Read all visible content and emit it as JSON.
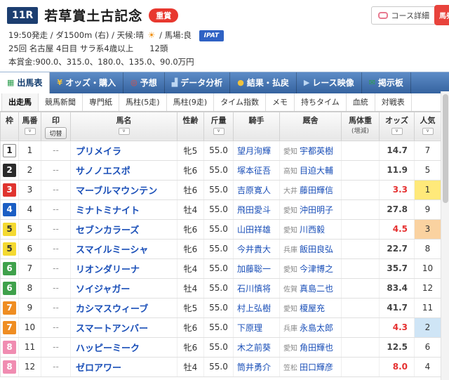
{
  "header": {
    "race_number": "11R",
    "race_name": "若草賞土古記念",
    "grade_badge": "重賞",
    "info1_a": "19:50発走 / ダ1500m (右) / 天候:晴",
    "sun_icon": "☀",
    "info1_b": "/ 馬場:良",
    "ipat": "IPAT",
    "info_line2": "25回 名古屋 4日目 サラ系4歳以上　　12頭",
    "info_line3": "本賞金:900.0、315.0、180.0、135.0、90.0万円",
    "course_detail_label": "コース詳細",
    "baken_label": "馬券"
  },
  "tabs": [
    {
      "label": "出馬表",
      "icon": "entry-table-icon",
      "icon_glyph": "▦",
      "icon_color": "green",
      "state": "active"
    },
    {
      "label": "オッズ・購入",
      "icon": "odds-purchase-icon",
      "icon_glyph": "¥",
      "icon_color": "gold",
      "state": "idle"
    },
    {
      "label": "予想",
      "icon": "prediction-icon",
      "icon_glyph": "◎",
      "icon_color": "red",
      "state": "idle"
    },
    {
      "label": "データ分析",
      "icon": "data-analysis-icon",
      "icon_glyph": "▟",
      "icon_color": "blue",
      "state": "idle"
    },
    {
      "label": "結果・払戻",
      "icon": "result-payout-icon",
      "icon_glyph": "●",
      "icon_color": "gold",
      "state": "idle"
    },
    {
      "label": "レース映像",
      "icon": "race-video-icon",
      "icon_glyph": "▶",
      "icon_color": "blue",
      "state": "idle"
    },
    {
      "label": "掲示板",
      "icon": "bbs-icon",
      "icon_glyph": "✉",
      "icon_color": "green",
      "state": "idle"
    }
  ],
  "subtabs": [
    {
      "label": "出走馬",
      "state": "active"
    },
    {
      "label": "競馬新聞",
      "state": "idle"
    },
    {
      "label": "専門紙",
      "state": "idle"
    },
    {
      "label": "馬柱(5走)",
      "state": "idle"
    },
    {
      "label": "馬柱(9走)",
      "state": "idle"
    },
    {
      "label": "タイム指数",
      "state": "idle"
    },
    {
      "label": "メモ",
      "state": "idle"
    },
    {
      "label": "持ちタイム",
      "state": "idle"
    },
    {
      "label": "血統",
      "state": "idle"
    },
    {
      "label": "対戦表",
      "state": "idle"
    }
  ],
  "table": {
    "headers": [
      {
        "label": "枠",
        "sub": "",
        "sort_glyph": "",
        "toggle": ""
      },
      {
        "label": "馬番",
        "sub": "",
        "sort_glyph": "∨",
        "toggle": ""
      },
      {
        "label": "印",
        "sub": "",
        "sort_glyph": "",
        "toggle": "切替"
      },
      {
        "label": "馬名",
        "sub": "",
        "sort_glyph": "∨",
        "toggle": ""
      },
      {
        "label": "性齢",
        "sub": "",
        "sort_glyph": "",
        "toggle": ""
      },
      {
        "label": "斤量",
        "sub": "",
        "sort_glyph": "∨",
        "toggle": ""
      },
      {
        "label": "騎手",
        "sub": "",
        "sort_glyph": "",
        "toggle": ""
      },
      {
        "label": "厩舎",
        "sub": "",
        "sort_glyph": "",
        "toggle": ""
      },
      {
        "label": "馬体重",
        "sub": "(増減)",
        "sort_glyph": "",
        "toggle": ""
      },
      {
        "label": "オッズ",
        "sub": "",
        "sort_glyph": "∨",
        "toggle": ""
      },
      {
        "label": "人気",
        "sub": "",
        "sort_glyph": "∨",
        "toggle": ""
      }
    ],
    "rows": [
      {
        "waku": "1",
        "num": "1",
        "mark": "--",
        "name": "プリメイラ",
        "sexage": "牝5",
        "weight": "55.0",
        "jockey": "望月洵輝",
        "region": "愛知",
        "trainer": "宇都英樹",
        "horse_weight": "",
        "odds": "14.7",
        "odds_style": "norm",
        "pop": "7",
        "pop_style": "n"
      },
      {
        "waku": "2",
        "num": "2",
        "mark": "--",
        "name": "サノノエスポ",
        "sexage": "牝6",
        "weight": "55.0",
        "jockey": "塚本征吾",
        "region": "高知",
        "trainer": "目迫大輔",
        "horse_weight": "",
        "odds": "11.9",
        "odds_style": "norm",
        "pop": "5",
        "pop_style": "n"
      },
      {
        "waku": "3",
        "num": "3",
        "mark": "--",
        "name": "マーブルマウンテン",
        "sexage": "牡6",
        "weight": "55.0",
        "jockey": "吉原寛人",
        "region": "大井",
        "trainer": "藤田輝信",
        "horse_weight": "",
        "odds": "3.3",
        "odds_style": "hot",
        "pop": "1",
        "pop_style": "r1"
      },
      {
        "waku": "4",
        "num": "4",
        "mark": "--",
        "name": "ミナトミナイト",
        "sexage": "牡4",
        "weight": "55.0",
        "jockey": "飛田愛斗",
        "region": "愛知",
        "trainer": "沖田明子",
        "horse_weight": "",
        "odds": "27.8",
        "odds_style": "norm",
        "pop": "9",
        "pop_style": "n"
      },
      {
        "waku": "5",
        "num": "5",
        "mark": "--",
        "name": "セブンカラーズ",
        "sexage": "牝6",
        "weight": "55.0",
        "jockey": "山田祥雄",
        "region": "愛知",
        "trainer": "川西毅",
        "horse_weight": "",
        "odds": "4.5",
        "odds_style": "hot",
        "pop": "3",
        "pop_style": "r3"
      },
      {
        "waku": "5",
        "num": "6",
        "mark": "--",
        "name": "スマイルミーシャ",
        "sexage": "牝6",
        "weight": "55.0",
        "jockey": "今井貴大",
        "region": "兵庫",
        "trainer": "飯田良弘",
        "horse_weight": "",
        "odds": "22.7",
        "odds_style": "norm",
        "pop": "8",
        "pop_style": "n"
      },
      {
        "waku": "6",
        "num": "7",
        "mark": "--",
        "name": "リオンダリーナ",
        "sexage": "牝4",
        "weight": "55.0",
        "jockey": "加藤聡一",
        "region": "愛知",
        "trainer": "今津博之",
        "horse_weight": "",
        "odds": "35.7",
        "odds_style": "norm",
        "pop": "10",
        "pop_style": "n"
      },
      {
        "waku": "6",
        "num": "8",
        "mark": "--",
        "name": "ソイジャガー",
        "sexage": "牡4",
        "weight": "55.0",
        "jockey": "石川慎将",
        "region": "佐賀",
        "trainer": "真島二也",
        "horse_weight": "",
        "odds": "83.4",
        "odds_style": "norm",
        "pop": "12",
        "pop_style": "n"
      },
      {
        "waku": "7",
        "num": "9",
        "mark": "--",
        "name": "カシマスウィーブ",
        "sexage": "牝5",
        "weight": "55.0",
        "jockey": "村上弘樹",
        "region": "愛知",
        "trainer": "榎屋充",
        "horse_weight": "",
        "odds": "41.7",
        "odds_style": "norm",
        "pop": "11",
        "pop_style": "n"
      },
      {
        "waku": "7",
        "num": "10",
        "mark": "--",
        "name": "スマートアンバー",
        "sexage": "牝6",
        "weight": "55.0",
        "jockey": "下原理",
        "region": "兵庫",
        "trainer": "永島太郎",
        "horse_weight": "",
        "odds": "4.3",
        "odds_style": "hot",
        "pop": "2",
        "pop_style": "r2"
      },
      {
        "waku": "8",
        "num": "11",
        "mark": "--",
        "name": "ハッピーミーク",
        "sexage": "牝6",
        "weight": "55.0",
        "jockey": "木之前葵",
        "region": "愛知",
        "trainer": "角田輝也",
        "horse_weight": "",
        "odds": "12.5",
        "odds_style": "norm",
        "pop": "6",
        "pop_style": "n"
      },
      {
        "waku": "8",
        "num": "12",
        "mark": "--",
        "name": "ゼロアワー",
        "sexage": "牡4",
        "weight": "55.0",
        "jockey": "筒井勇介",
        "region": "笠松",
        "trainer": "田口輝彦",
        "horse_weight": "",
        "odds": "8.0",
        "odds_style": "hot",
        "pop": "4",
        "pop_style": "n"
      }
    ]
  },
  "colors": {
    "accent_navy": "#1c3e70",
    "grade_red": "#e8382f",
    "tab_blue": "#35639f",
    "link_blue": "#1a4fb8",
    "hot_odds_red": "#e53030",
    "pop1_bg": "#ffe97a",
    "pop2_bg": "#cfe5f6",
    "pop3_bg": "#fad2a0"
  }
}
